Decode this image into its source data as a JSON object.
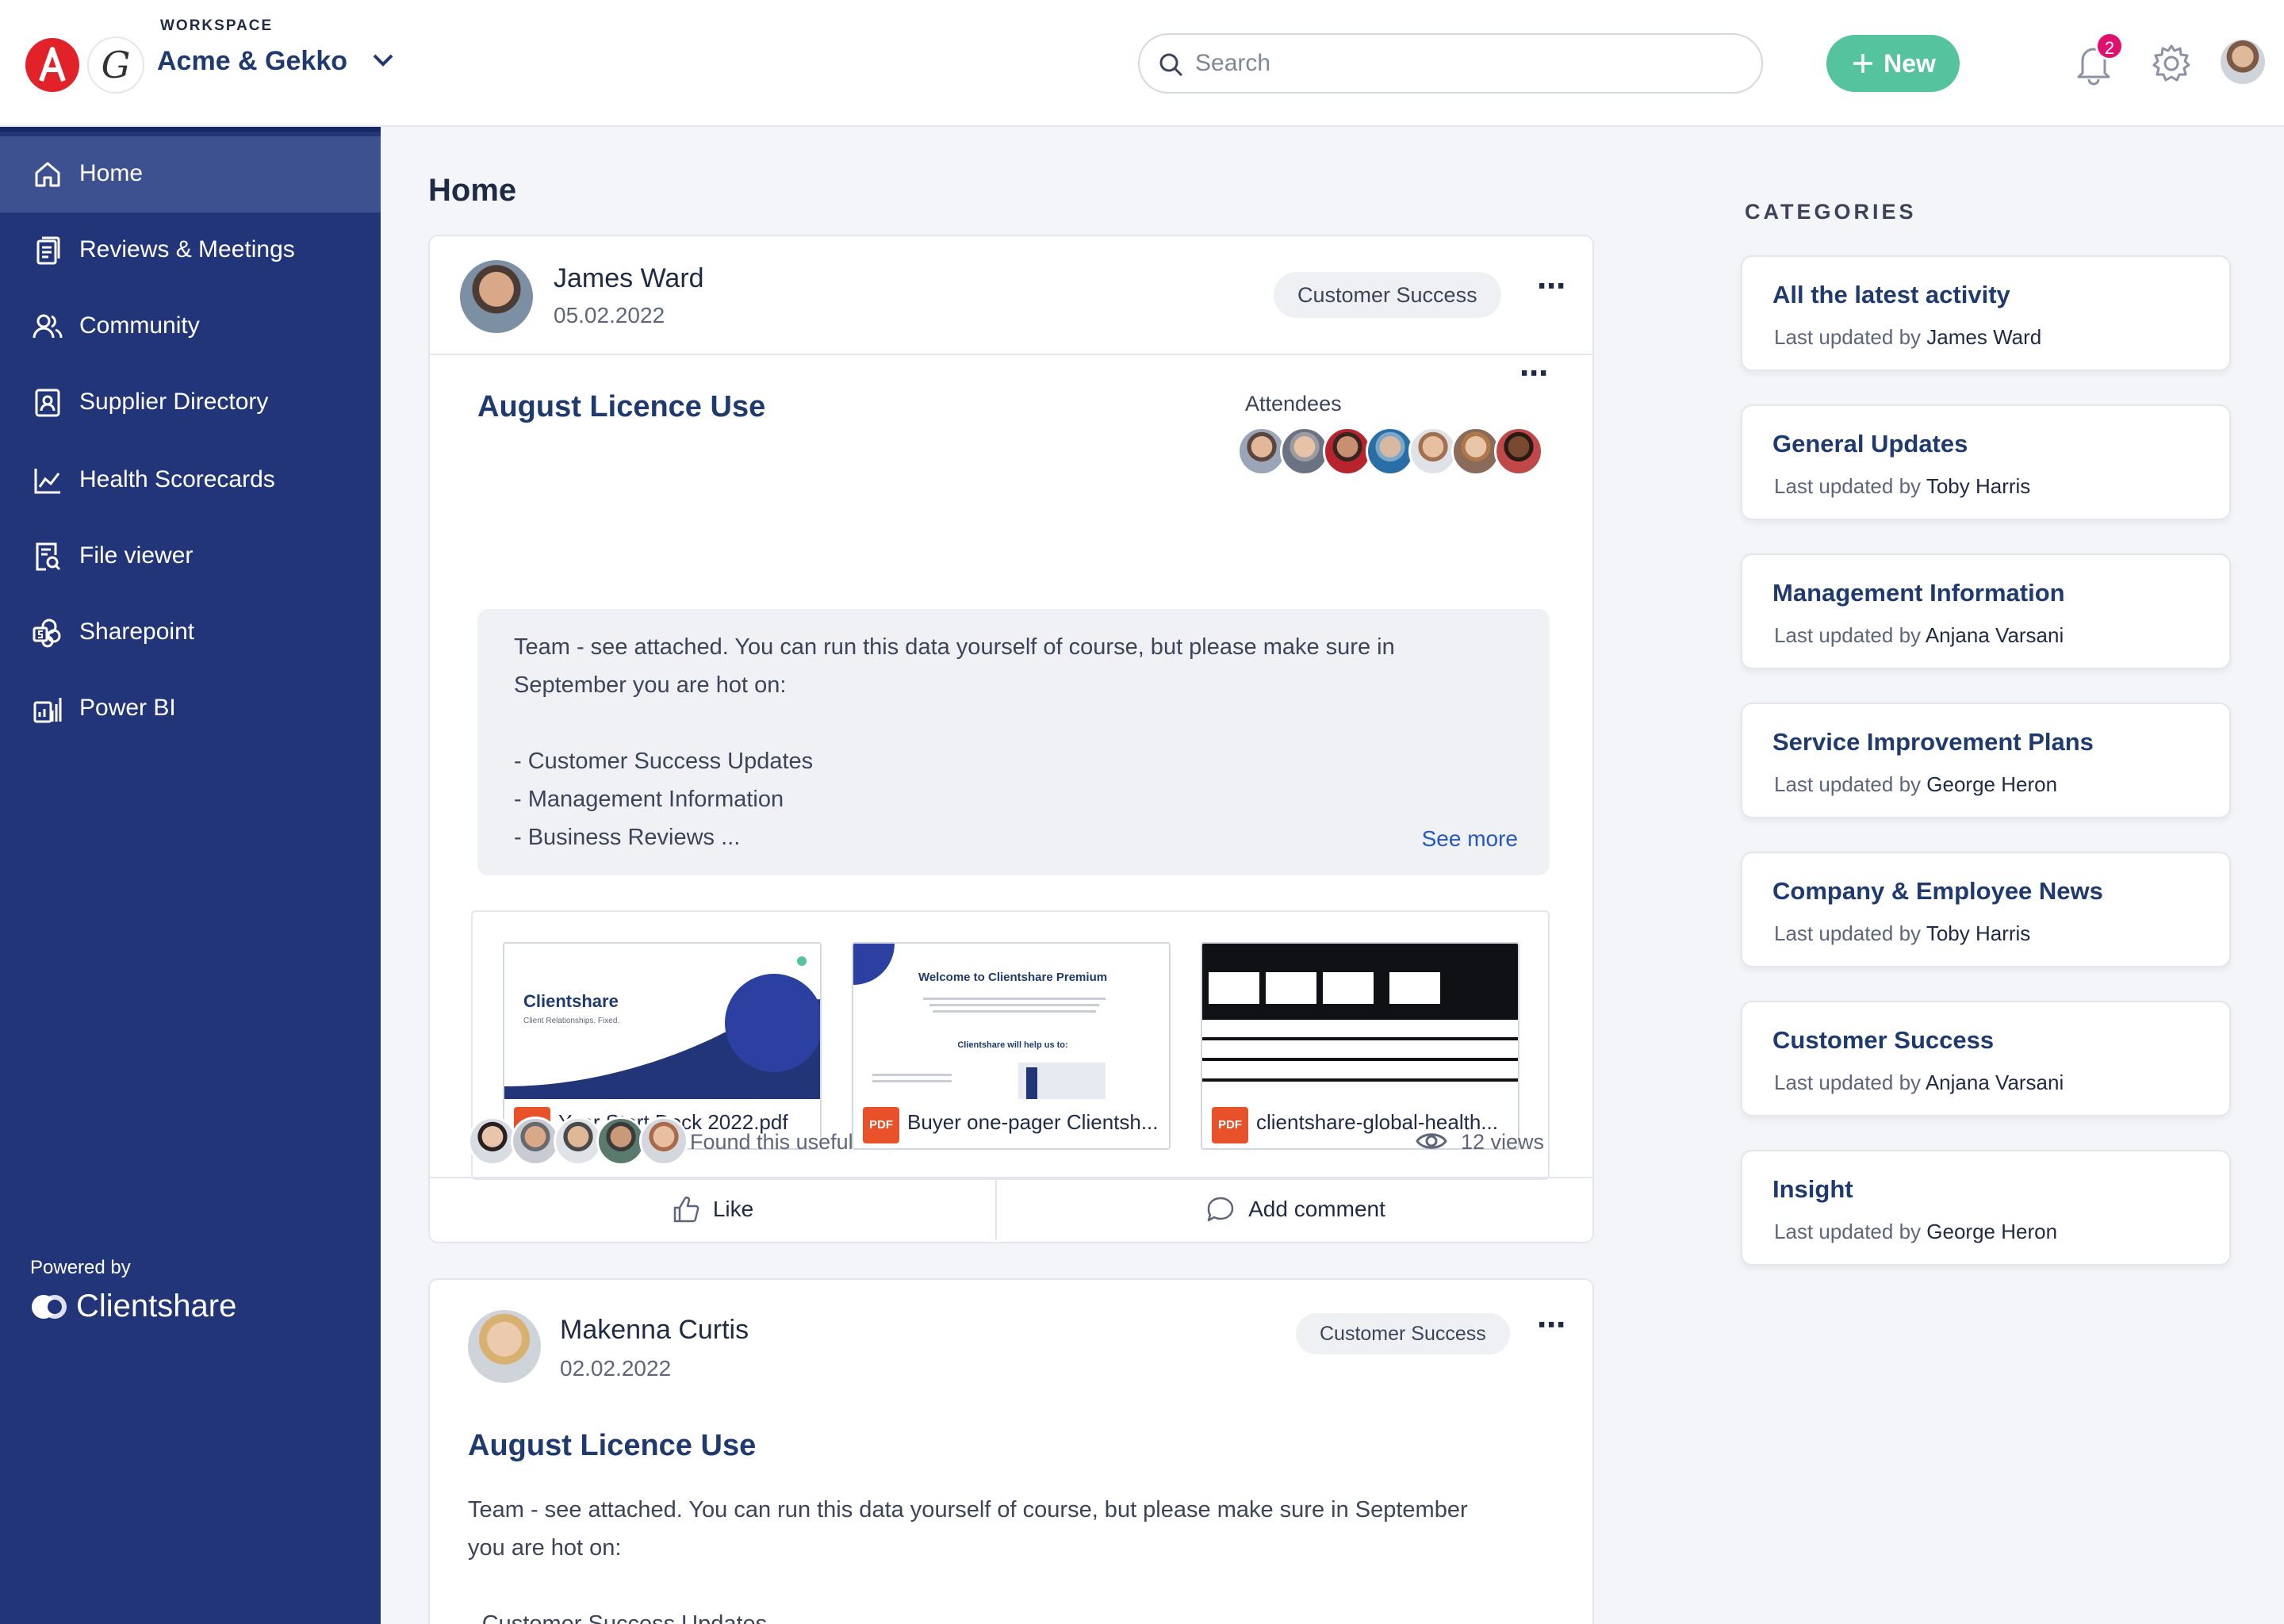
{
  "workspace": {
    "label": "WORKSPACE",
    "name": "Acme & Gekko",
    "logo_letter": "G"
  },
  "search": {
    "placeholder": "Search"
  },
  "header": {
    "new_label": "New",
    "notifications_count": "2"
  },
  "sidebar": {
    "items": [
      {
        "label": "Home",
        "icon": "home-icon",
        "active": true
      },
      {
        "label": "Reviews & Meetings",
        "icon": "document-icon"
      },
      {
        "label": "Community",
        "icon": "users-icon"
      },
      {
        "label": "Supplier Directory",
        "icon": "contact-card-icon"
      },
      {
        "label": "Health Scorecards",
        "icon": "line-chart-icon"
      },
      {
        "label": "File viewer",
        "icon": "file-search-icon"
      },
      {
        "label": "Sharepoint",
        "icon": "sharepoint-icon"
      },
      {
        "label": "Power BI",
        "icon": "bar-chart-icon"
      }
    ],
    "powered_by": "Powered by",
    "brand": "Clientshare"
  },
  "main": {
    "title": "Home",
    "posts": [
      {
        "author": "James Ward",
        "date": "05.02.2022",
        "category": "Customer Success",
        "title": "August Licence Use",
        "attendees_label": "Attendees",
        "body": [
          "Team - see attached. You can run this data yourself of course, but please make sure in",
          "September you are hot on:",
          "",
          "- Customer Success Updates",
          "- Management Information",
          "- Business Reviews ..."
        ],
        "see_more": "See more",
        "files": [
          {
            "name": "Year Start Deck 2022.pdf",
            "type": "PDF",
            "thumb_title": "Clientshare",
            "thumb_sub": "Client Relationships. Fixed."
          },
          {
            "name": "Buyer one-pager Clientsh...",
            "type": "PDF",
            "thumb_title": "Welcome to Clientshare Premium",
            "thumb_sub": "Clientshare will help us to:"
          },
          {
            "name": "clientshare-global-health...",
            "type": "PDF"
          }
        ],
        "useful_label": "Found this useful",
        "views": "12 views",
        "like_label": "Like",
        "comment_label": "Add comment"
      },
      {
        "author": "Makenna Curtis",
        "date": "02.02.2022",
        "category": "Customer Success",
        "title": "August Licence Use",
        "body": [
          "Team - see attached. You can run this data yourself of course, but please make sure in September",
          "you are hot on:",
          "",
          "- Customer Success Updates"
        ]
      }
    ]
  },
  "categories": {
    "heading": "CATEGORIES",
    "updated_prefix": "Last updated by",
    "items": [
      {
        "title": "All the latest activity",
        "by": "James Ward"
      },
      {
        "title": "General Updates",
        "by": "Toby Harris"
      },
      {
        "title": "Management Information",
        "by": "Anjana Varsani"
      },
      {
        "title": "Service Improvement Plans",
        "by": "George Heron"
      },
      {
        "title": "Company & Employee News",
        "by": "Toby Harris"
      },
      {
        "title": "Customer Success",
        "by": "Anjana Varsani"
      },
      {
        "title": "Insight",
        "by": "George Heron"
      }
    ]
  },
  "colors": {
    "sidebar": "#213578",
    "accent": "#55c39e",
    "link": "#2457c5",
    "badge": "#e0116e"
  }
}
